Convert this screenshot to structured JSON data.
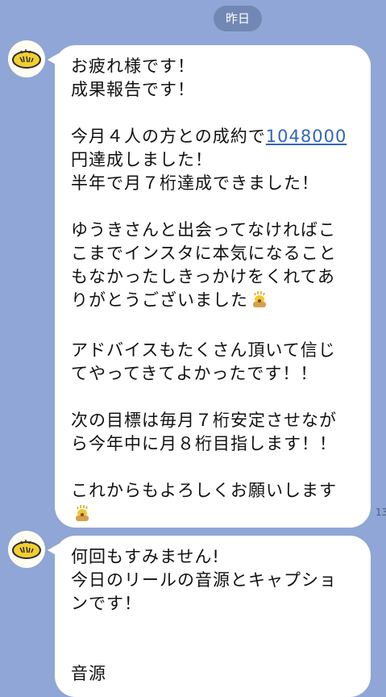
{
  "date_separator": "昨日",
  "messages": [
    {
      "lines": [
        "お疲れ様です！",
        "成果報告です！",
        "",
        [
          "今月４人の方との成約で",
          "1048000"
        ],
        "円達成しました！",
        "半年で月７桁達成できました！",
        "",
        "ゆうきさんと出会ってなければこ",
        "こまでインスタに本気になること",
        "もなかったしきっかけをくれてあ",
        "りがとうございました",
        "",
        "アドバイスもたくさん頂いて信じ",
        "てやってきてよかったです！！",
        "",
        "次の目標は毎月７桁安定させなが",
        "ら今年中に月８桁目指します！！",
        "",
        "これからもよろしくお願いします"
      ],
      "emoji": "bowing-person-emoji",
      "timestamp": "13"
    },
    {
      "lines": [
        "何回もすみません!",
        "今日のリールの音源とキャプショ",
        "ンです！",
        "",
        "",
        "音源"
      ]
    }
  ],
  "colors": {
    "background": "#8fa6d6",
    "bubble": "#ffffff",
    "link": "#3366bb"
  }
}
